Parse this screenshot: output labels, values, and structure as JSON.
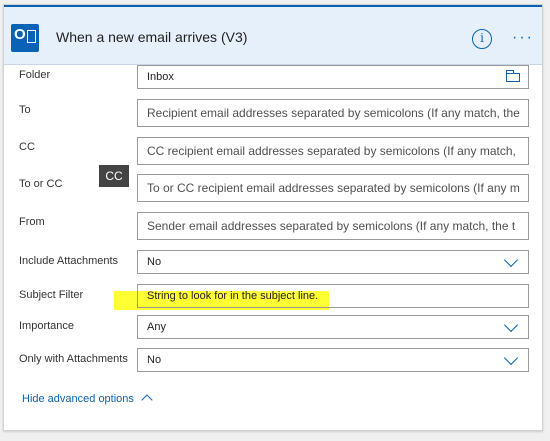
{
  "header": {
    "title": "When a new email arrives (V3)",
    "info_icon": "info-icon",
    "more_icon": "more-options-icon",
    "app_icon": "outlook-icon",
    "accent_color": "#0a62b5"
  },
  "fields": {
    "folder": {
      "label": "Folder",
      "value": "Inbox",
      "icon": "folder-icon"
    },
    "to": {
      "label": "To",
      "placeholder": "Recipient email addresses separated by semicolons (If any match, the"
    },
    "cc": {
      "label": "CC",
      "placeholder": "CC recipient email addresses separated by semicolons (If any match,"
    },
    "to_or_cc": {
      "label": "To or CC",
      "placeholder": "To or CC recipient email addresses separated by semicolons (If any m"
    },
    "from": {
      "label": "From",
      "placeholder": "Sender email addresses separated by semicolons (If any match, the t"
    },
    "include_attachments": {
      "label": "Include Attachments",
      "value": "No"
    },
    "subject_filter": {
      "label": "Subject Filter",
      "placeholder": "String to look for in the subject line."
    },
    "importance": {
      "label": "Importance",
      "value": "Any"
    },
    "only_with_attachments": {
      "label": "Only with Attachments",
      "value": "No"
    }
  },
  "tooltip": {
    "text": "CC"
  },
  "footer": {
    "hide_advanced": "Hide advanced options"
  },
  "highlight_color": "#ffff33"
}
